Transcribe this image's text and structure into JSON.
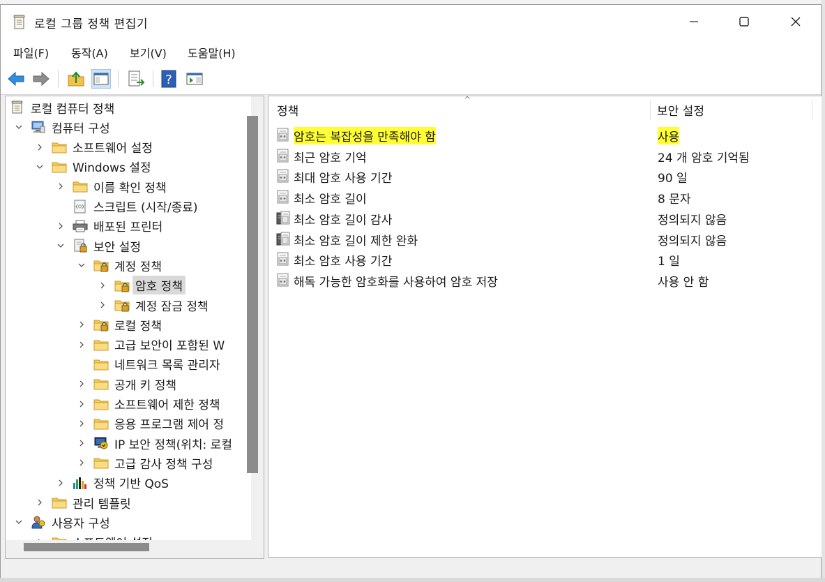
{
  "window": {
    "title": "로컬 그룹 정책 편집기",
    "icons": {
      "app": "scroll-document-icon",
      "minimize": "minimize-icon",
      "maximize": "maximize-icon",
      "close": "close-icon"
    }
  },
  "menu": [
    {
      "label": "파일(F)"
    },
    {
      "label": "동작(A)"
    },
    {
      "label": "보기(V)"
    },
    {
      "label": "도움말(H)"
    }
  ],
  "toolbar": [
    "back-arrow-icon",
    "forward-arrow-icon",
    "up-folder-icon",
    "show-hide-tree-icon",
    "export-list-icon",
    "help-icon",
    "action-pane-icon"
  ],
  "tree": [
    {
      "label": "로컬 컴퓨터 정책",
      "icon": "policy-scroll-icon",
      "expander": ""
    },
    {
      "label": "컴퓨터 구성",
      "icon": "computer-icon",
      "expander": "expanded"
    },
    {
      "label": "소프트웨어 설정",
      "icon": "folder-icon",
      "expander": "collapsed"
    },
    {
      "label": "Windows 설정",
      "icon": "folder-icon",
      "expander": "expanded"
    },
    {
      "label": "이름 확인 정책",
      "icon": "folder-icon",
      "expander": "collapsed"
    },
    {
      "label": "스크립트 (시작/종료)",
      "icon": "script-icon",
      "expander": ""
    },
    {
      "label": "배포된 프린터",
      "icon": "printer-icon",
      "expander": "collapsed"
    },
    {
      "label": "보안 설정",
      "icon": "security-icon",
      "expander": "expanded"
    },
    {
      "label": "계정 정책",
      "icon": "lock-folder-icon",
      "expander": "expanded"
    },
    {
      "label": "암호 정책",
      "icon": "lock-folder-icon",
      "expander": "collapsed",
      "selected": true
    },
    {
      "label": "계정 잠금 정책",
      "icon": "lock-folder-icon",
      "expander": "collapsed"
    },
    {
      "label": "로컬 정책",
      "icon": "lock-folder-icon",
      "expander": "collapsed"
    },
    {
      "label": "고급 보안이 포함된 W",
      "icon": "folder-icon",
      "expander": "collapsed"
    },
    {
      "label": "네트워크 목록 관리자",
      "icon": "folder-icon",
      "expander": ""
    },
    {
      "label": "공개 키 정책",
      "icon": "folder-icon",
      "expander": "collapsed"
    },
    {
      "label": "소프트웨어 제한 정책",
      "icon": "folder-icon",
      "expander": "collapsed"
    },
    {
      "label": "응용 프로그램 제어 정",
      "icon": "folder-icon",
      "expander": "collapsed"
    },
    {
      "label": "IP 보안 정책(위치: 로컬",
      "icon": "ip-security-icon",
      "expander": "collapsed"
    },
    {
      "label": "고급 감사 정책 구성",
      "icon": "folder-icon",
      "expander": "collapsed"
    },
    {
      "label": "정책 기반 QoS",
      "icon": "bar-chart-icon",
      "expander": "collapsed"
    },
    {
      "label": "관리 템플릿",
      "icon": "folder-icon",
      "expander": "collapsed"
    },
    {
      "label": "사용자 구성",
      "icon": "user-icon",
      "expander": "expanded"
    },
    {
      "label": "소프트웨어 설정",
      "icon": "folder-icon",
      "expander": "collapsed"
    }
  ],
  "list": {
    "columns": [
      "정책",
      "보안 설정"
    ],
    "rows": [
      {
        "name": "암호는 복잡성을 만족해야 함",
        "value": "사용",
        "icon": "policy-item-icon",
        "highlight": true
      },
      {
        "name": "최근 암호 기억",
        "value": "24 개 암호 기억됨",
        "icon": "policy-item-icon"
      },
      {
        "name": "최대 암호 사용 기간",
        "value": "90 일",
        "icon": "policy-item-icon"
      },
      {
        "name": "최소 암호 길이",
        "value": "8 문자",
        "icon": "policy-item-icon"
      },
      {
        "name": "최소 암호 길이 감사",
        "value": "정의되지 않음",
        "icon": "policy-server-icon"
      },
      {
        "name": "최소 암호 길이 제한 완화",
        "value": "정의되지 않음",
        "icon": "policy-server-icon"
      },
      {
        "name": "최소 암호 사용 기간",
        "value": "1 일",
        "icon": "policy-item-icon"
      },
      {
        "name": "해독 가능한 암호화를 사용하여 암호 저장",
        "value": "사용 안 함",
        "icon": "policy-item-icon"
      }
    ]
  },
  "colors": {
    "highlight": "#ffff33",
    "folder": "#f2c14e",
    "selection": "#d9d9d9"
  }
}
